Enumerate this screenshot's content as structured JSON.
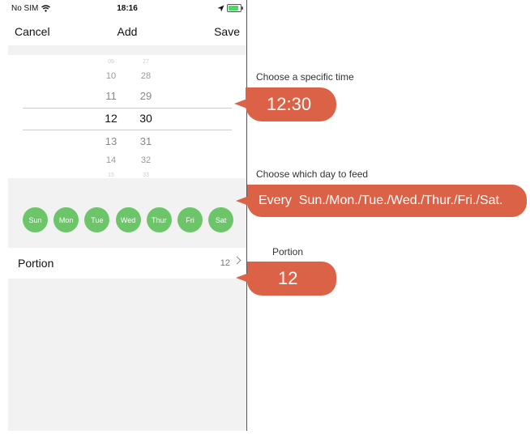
{
  "status_bar": {
    "carrier": "No SIM",
    "time": "18:16"
  },
  "nav": {
    "cancel_label": "Cancel",
    "title": "Add",
    "save_label": "Save"
  },
  "picker": {
    "hours": [
      "09",
      "10",
      "11",
      "12",
      "13",
      "14",
      "15"
    ],
    "minutes": [
      "27",
      "28",
      "29",
      "30",
      "31",
      "32",
      "33"
    ],
    "selected_hour": "12",
    "selected_minute": "30"
  },
  "days": [
    "Sun",
    "Mon",
    "Tue",
    "Wed",
    "Thur",
    "Fri",
    "Sat"
  ],
  "portion": {
    "label": "Portion",
    "value": "12"
  },
  "annotations": {
    "time_caption": "Choose a specific time",
    "time_value": "12:30",
    "day_caption": "Choose which day to feed",
    "day_value": "Every  Sun./Mon./Tue./Wed./Thur./Fri./Sat.",
    "portion_caption": "Portion",
    "portion_value": "12"
  },
  "colors": {
    "accent_bubble": "#dc6247",
    "day_chip": "#6dc56a"
  }
}
